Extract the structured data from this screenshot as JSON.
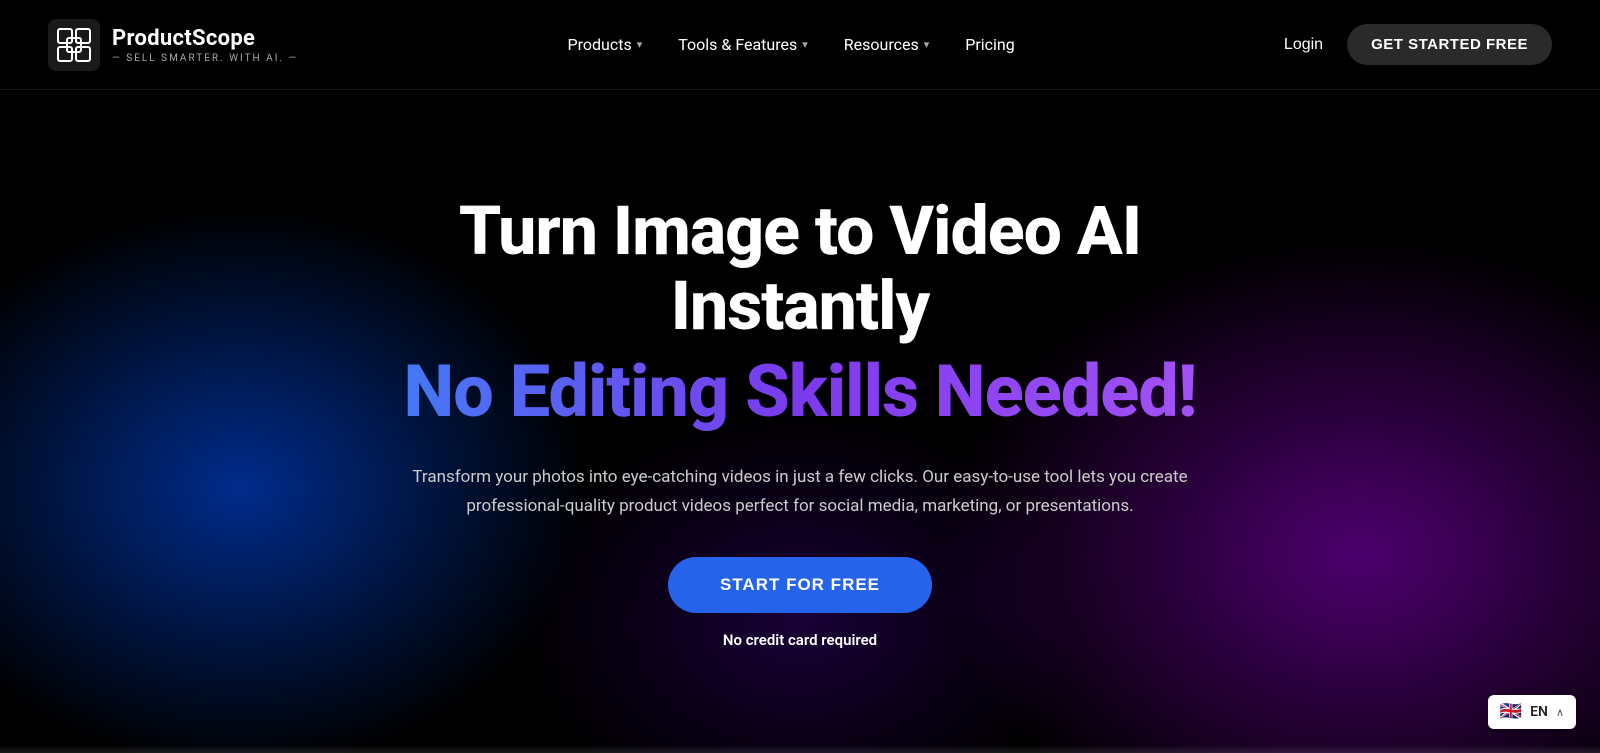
{
  "navbar": {
    "logo": {
      "name": "ProductScope",
      "tagline": "— SELL SMARTER. WITH AI. —"
    },
    "nav_items": [
      {
        "label": "Products",
        "has_dropdown": true
      },
      {
        "label": "Tools & Features",
        "has_dropdown": true
      },
      {
        "label": "Resources",
        "has_dropdown": true
      },
      {
        "label": "Pricing",
        "has_dropdown": false
      }
    ],
    "login_label": "Login",
    "get_started_label": "GET STARTED FREE"
  },
  "hero": {
    "title_main": "Turn Image to Video AI Instantly",
    "title_gradient": "No Editing Skills Needed!",
    "description": "Transform your photos into eye-catching videos in just a few clicks. Our easy-to-use tool lets you create professional-quality product videos perfect for social media, marketing, or presentations.",
    "cta_button": "START FOR FREE",
    "cta_sub": "No credit card required"
  },
  "language": {
    "flag": "🇬🇧",
    "code": "EN",
    "chevron": "∧"
  }
}
